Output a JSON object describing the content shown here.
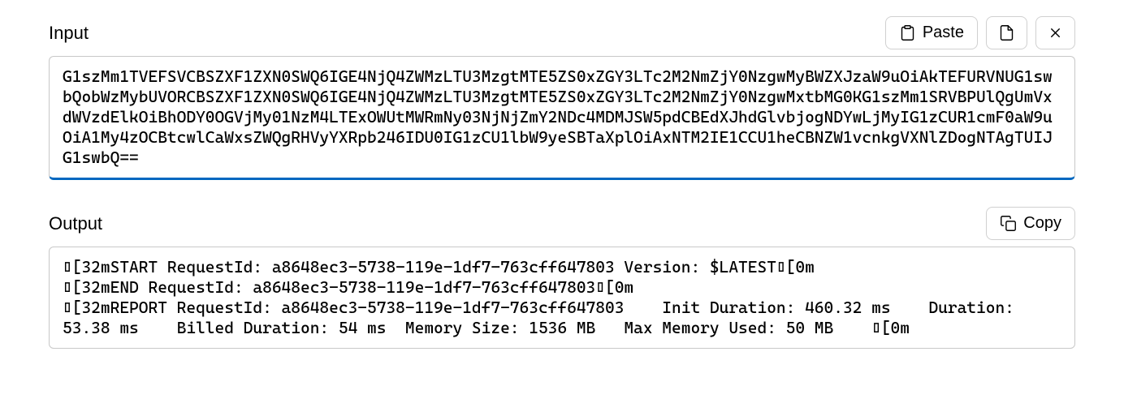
{
  "input": {
    "label": "Input",
    "paste_label": "Paste",
    "value": "G1szMm1TVEFSVCBSZXF1ZXN0SWQ6IGE4NjQ4ZWMzLTU3MzgtMTE5ZS0xZGY3LTc2M2NmZjY0NzgwMyBWZXJzaW9uOiAkTEFURVNUG1swbQobWzMybUVORCBSZXF1ZXN0SWQ6IGE4NjQ4ZWMzLTU3MzgtMTE5ZS0xZGY3LTc2M2NmZjY0NzgwMxtbMG0KG1szMm1SRVBPUlQgUmVxdWVzdElkOiBhODY0OGVjMy01NzM4LTExOWUtMWRmNy03NjNjZmY2NDc4MDMJSW5pdCBEdXJhdGlvbjogNDYwLjMyIG1zCUR1cmF0aW9uOiA1My4zOCBtcwlCaWxsZWQgRHVyYXRpb246IDU0IG1zCU1lbW9yeSBTaXplOiAxNTM2IE1CCU1heCBNZW1vcnkgVXNlZDogNTAgTUIJG1swbQ=="
  },
  "output": {
    "label": "Output",
    "copy_label": "Copy",
    "value": "▯[32mSTART RequestId: a8648ec3-5738-119e-1df7-763cff647803 Version: $LATEST▯[0m\n▯[32mEND RequestId: a8648ec3-5738-119e-1df7-763cff647803▯[0m\n▯[32mREPORT RequestId: a8648ec3-5738-119e-1df7-763cff647803    Init Duration: 460.32 ms    Duration: 53.38 ms    Billed Duration: 54 ms  Memory Size: 1536 MB   Max Memory Used: 50 MB    ▯[0m"
  }
}
